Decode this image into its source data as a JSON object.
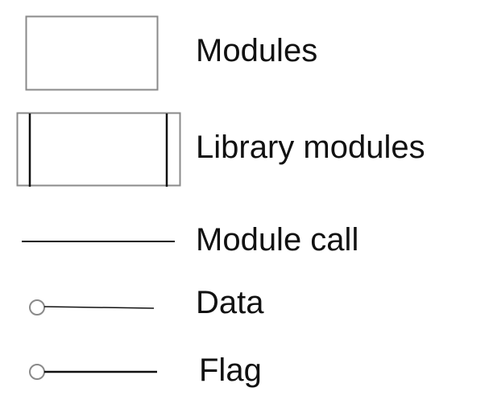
{
  "legend": {
    "items": [
      {
        "label": "Modules"
      },
      {
        "label": "Library modules"
      },
      {
        "label": "Module call"
      },
      {
        "label": "Data"
      },
      {
        "label": "Flag"
      }
    ]
  },
  "colors": {
    "box_stroke": "#8a8a8a",
    "line": "#111111",
    "circle_stroke": "#8a8a8a"
  }
}
